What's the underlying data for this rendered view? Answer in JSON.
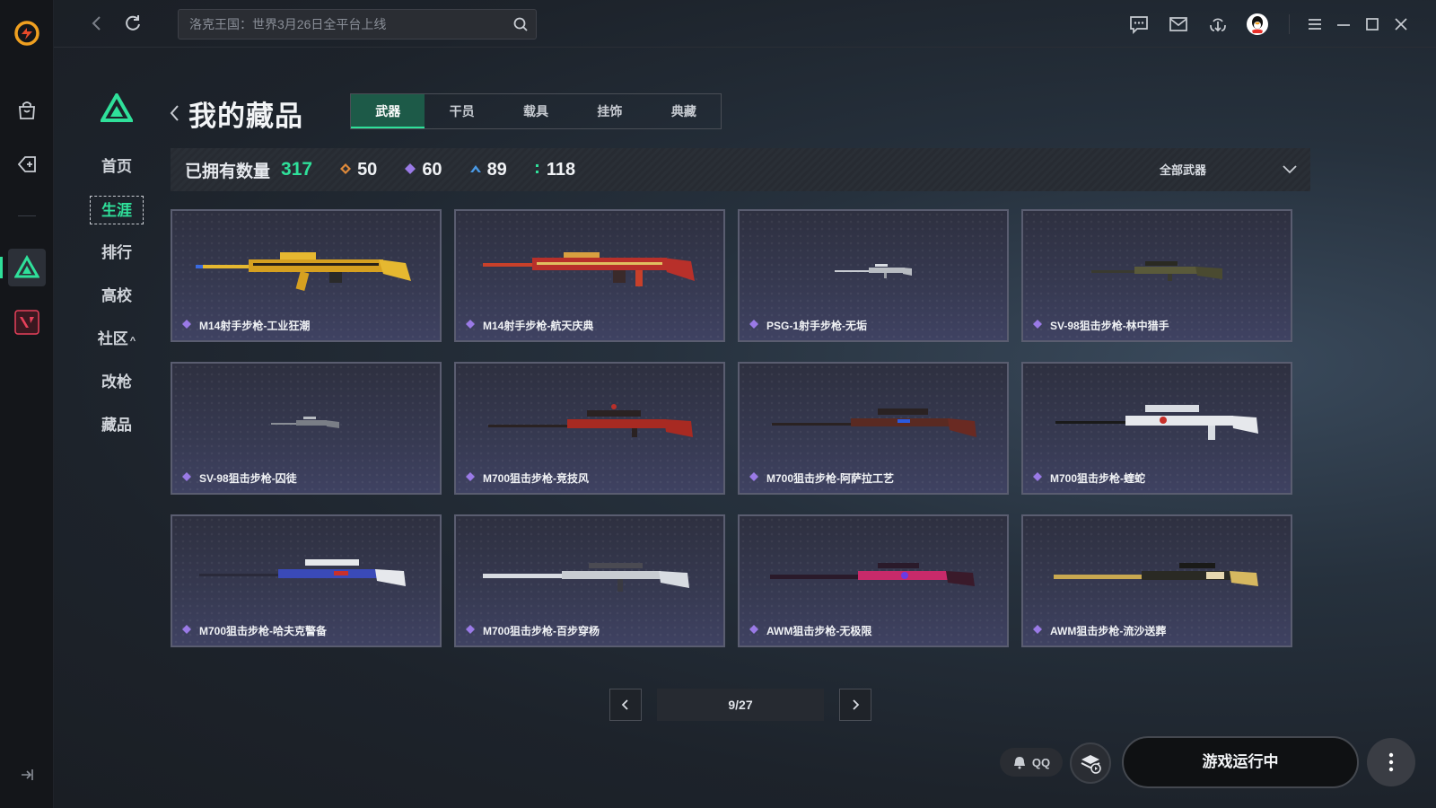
{
  "search": {
    "placeholder": "洛克王国：世界3月26日全平台上线"
  },
  "side_nav": {
    "items": [
      {
        "label": "首页"
      },
      {
        "label": "生涯"
      },
      {
        "label": "排行"
      },
      {
        "label": "高校"
      },
      {
        "label": "社区",
        "caret": "^"
      },
      {
        "label": "改枪"
      },
      {
        "label": "藏品"
      }
    ]
  },
  "page": {
    "title": "我的藏品"
  },
  "tabs": [
    {
      "label": "武器"
    },
    {
      "label": "干员"
    },
    {
      "label": "载具"
    },
    {
      "label": "挂饰"
    },
    {
      "label": "典藏"
    }
  ],
  "stats": {
    "label": "已拥有数量",
    "total": "317",
    "counts": [
      {
        "value": "50",
        "color": "#e08a3a"
      },
      {
        "value": "60",
        "color": "#9a7ae6"
      },
      {
        "value": "89",
        "color": "#4a9ae6"
      },
      {
        "value": "118",
        "color": "#2fe09a"
      }
    ],
    "filter": "全部武器"
  },
  "items": [
    {
      "name": "M14射手步枪-工业狂潮",
      "gem_color": "#9a7ae6"
    },
    {
      "name": "M14射手步枪-航天庆典",
      "gem_color": "#9a7ae6"
    },
    {
      "name": "PSG-1射手步枪-无垢",
      "gem_color": "#9a7ae6"
    },
    {
      "name": "SV-98狙击步枪-林中猎手",
      "gem_color": "#9a7ae6"
    },
    {
      "name": "SV-98狙击步枪-囚徒",
      "gem_color": "#9a7ae6"
    },
    {
      "name": "M700狙击步枪-竞技风",
      "gem_color": "#9a7ae6"
    },
    {
      "name": "M700狙击步枪-阿萨拉工艺",
      "gem_color": "#9a7ae6"
    },
    {
      "name": "M700狙击步枪-蝰蛇",
      "gem_color": "#9a7ae6"
    },
    {
      "name": "M700狙击步枪-哈夫克警备",
      "gem_color": "#9a7ae6"
    },
    {
      "name": "M700狙击步枪-百步穿杨",
      "gem_color": "#9a7ae6"
    },
    {
      "name": "AWM狙击步枪-无极限",
      "gem_color": "#9a7ae6"
    },
    {
      "name": "AWM狙击步枪-流沙送葬",
      "gem_color": "#9a7ae6"
    }
  ],
  "pagination": {
    "current": "9/27"
  },
  "footer": {
    "qq_label": "QQ",
    "run_label": "游戏运行中"
  },
  "colors": {
    "accent": "#2fe09a",
    "brand": "#f0a020"
  }
}
